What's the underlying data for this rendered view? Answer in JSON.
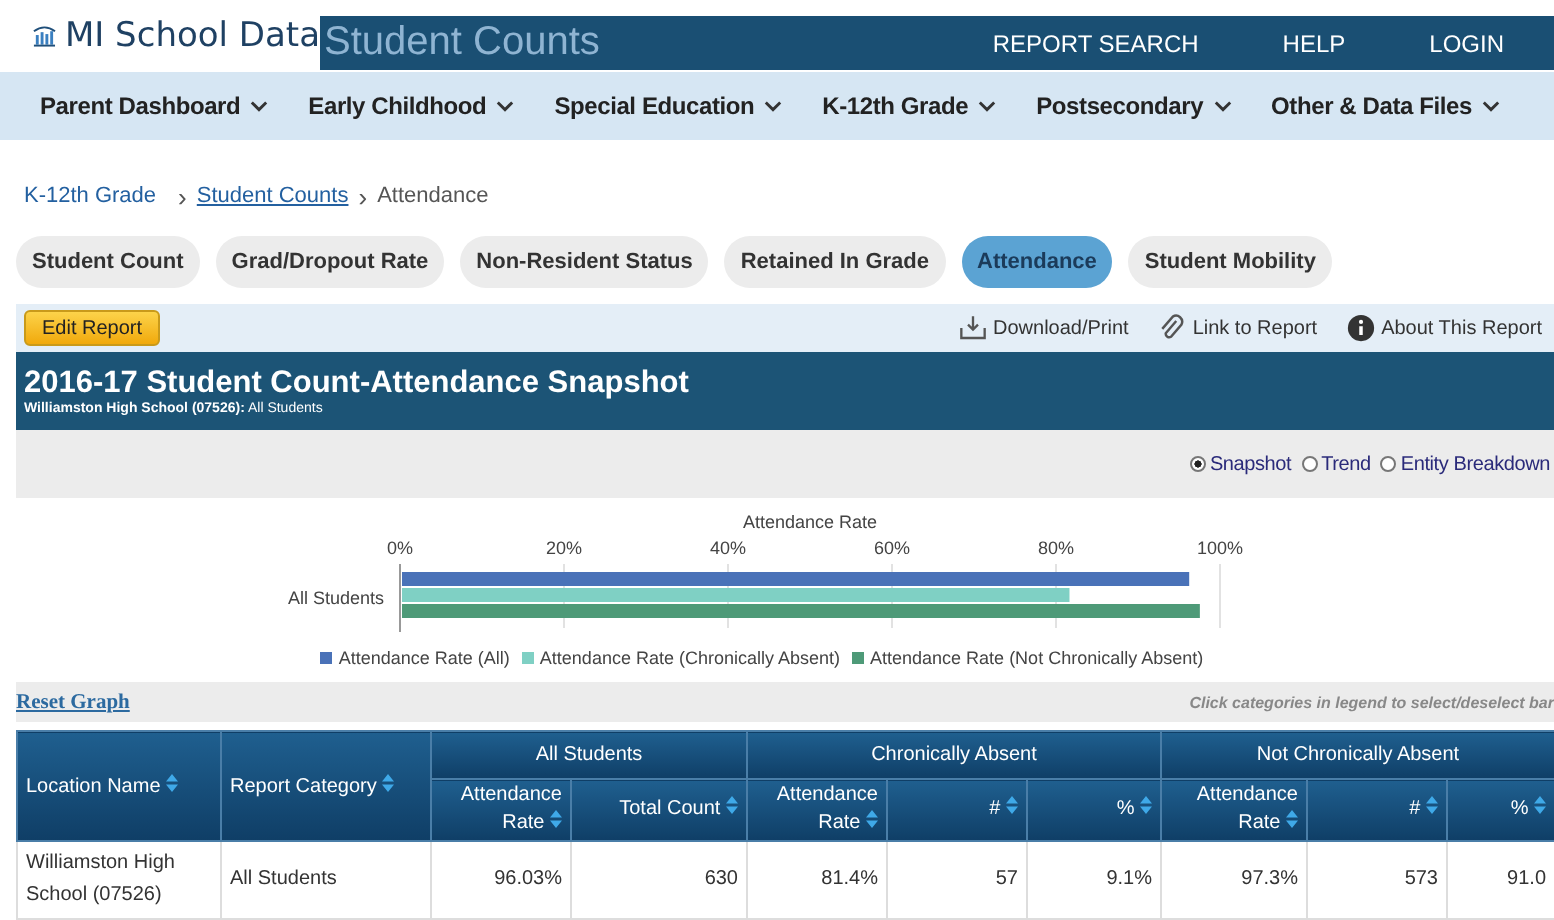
{
  "header": {
    "logo": "MI School Data",
    "page_title": "Student Counts",
    "links": [
      "REPORT SEARCH",
      "HELP",
      "LOGIN"
    ]
  },
  "nav": [
    "Parent Dashboard",
    "Early Childhood",
    "Special Education",
    "K-12th Grade",
    "Postsecondary",
    "Other & Data Files"
  ],
  "breadcrumb": [
    {
      "label": "K-12th Grade",
      "link": false
    },
    {
      "separator": "›",
      "label": "Student Counts",
      "link": true
    },
    {
      "separator": "›",
      "label": "Attendance",
      "link": false
    }
  ],
  "tabs": [
    {
      "label": "Student Count",
      "selected": false
    },
    {
      "label": "Grad/Dropout Rate",
      "selected": false
    },
    {
      "label": "Non-Resident Status",
      "selected": false
    },
    {
      "label": "Retained In Grade",
      "selected": false
    },
    {
      "label": "Attendance",
      "selected": true
    },
    {
      "label": "Student Mobility",
      "selected": false
    }
  ],
  "toolbar": {
    "edit": "Edit Report",
    "actions": [
      {
        "kind": "download",
        "label": "Download/Print"
      },
      {
        "kind": "link",
        "label": "Link to Report"
      },
      {
        "kind": "info",
        "label": "About This Report"
      }
    ]
  },
  "report": {
    "title": "2016-17 Student Count-Attendance Snapshot",
    "subtitle_bold": "Williamston High School (07526):",
    "subtitle": "All Students"
  },
  "views": [
    {
      "label": "Snapshot",
      "selected": true
    },
    {
      "label": "Trend",
      "selected": false
    },
    {
      "label": "Entity Breakdown",
      "selected": false
    }
  ],
  "chart_data": {
    "type": "bar",
    "orientation": "horizontal",
    "grid": true,
    "legend": true,
    "xlabel": "Attendance Rate",
    "categories": [
      "All Students"
    ],
    "xlim": [
      0,
      100
    ],
    "xticks": [
      {
        "value": 0,
        "label": "0%"
      },
      {
        "value": 20,
        "label": "20%"
      },
      {
        "value": 40,
        "label": "40%"
      },
      {
        "value": 60,
        "label": "60%"
      },
      {
        "value": 80,
        "label": "80%"
      },
      {
        "value": 100,
        "label": "100%"
      }
    ],
    "series": [
      {
        "name": "Attendance Rate (All)",
        "color": "#4a72b8",
        "values": [
          96.0
        ]
      },
      {
        "name": "Attendance Rate (Chronically Absent)",
        "color": "#7fd0c4",
        "values": [
          81.4
        ]
      },
      {
        "name": "Attendance Rate (Not Chronically Absent)",
        "color": "#4e9a78",
        "values": [
          97.3
        ]
      }
    ]
  },
  "graph_bar": {
    "reset": "Reset Graph",
    "hint": "Click categories in legend to select/deselect bar"
  },
  "table": {
    "groups": [
      "All Students",
      "Chronically Absent",
      "Not Chronically Absent"
    ],
    "columns": [
      "Location Name",
      "Report Category",
      "Attendance Rate",
      "Total Count",
      "Attendance Rate",
      "#",
      "%",
      "Attendance Rate",
      "#",
      "%"
    ],
    "rows": [
      [
        "Williamston High School (07526)",
        "All Students",
        "96.03%",
        "630",
        "81.4%",
        "57",
        "9.1%",
        "97.3%",
        "573",
        "91.0"
      ]
    ]
  }
}
